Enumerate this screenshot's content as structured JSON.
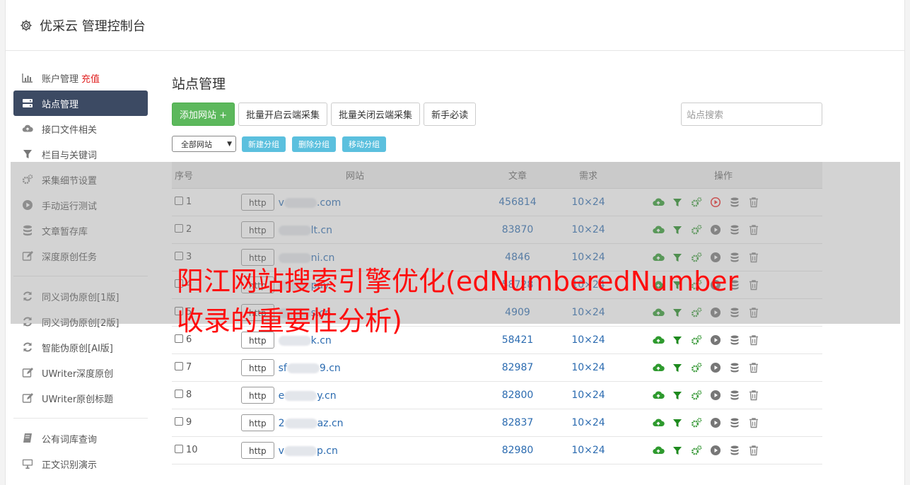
{
  "header": {
    "title": "优采云 管理控制台"
  },
  "sidebar": {
    "group1": [
      {
        "label": "账户管理",
        "extra": "充值",
        "icon": "bar-chart-icon"
      },
      {
        "label": "站点管理",
        "icon": "server-icon",
        "active": true
      },
      {
        "label": "接口文件相关",
        "icon": "cloud-upload-icon"
      },
      {
        "label": "栏目与关键词",
        "icon": "filter-icon"
      },
      {
        "label": "采集细节设置",
        "icon": "cogs-icon"
      },
      {
        "label": "手动运行测试",
        "icon": "play-circle-icon"
      },
      {
        "label": "文章暂存库",
        "icon": "database-icon"
      },
      {
        "label": "深度原创任务",
        "icon": "edit-icon"
      }
    ],
    "group2": [
      {
        "label": "同义词伪原创[1版]",
        "icon": "refresh-icon"
      },
      {
        "label": "同义词伪原创[2版]",
        "icon": "refresh-icon"
      },
      {
        "label": "智能伪原创[AI版]",
        "icon": "refresh-icon"
      },
      {
        "label": "UWriter深度原创",
        "icon": "edit-icon"
      },
      {
        "label": "UWriter原创标题",
        "icon": "edit-icon"
      }
    ],
    "group3": [
      {
        "label": "公有词库查询",
        "icon": "book-icon"
      },
      {
        "label": "正文识别演示",
        "icon": "monitor-icon"
      }
    ]
  },
  "main": {
    "title": "站点管理",
    "add_button": "添加网站 +",
    "batch_open": "批量开启云端采集",
    "batch_close": "批量关闭云端采集",
    "newbie": "新手必读",
    "search_placeholder": "站点搜索",
    "group_select": "全部网站",
    "new_group": "新建分组",
    "delete_group": "删除分组",
    "move_group": "移动分组"
  },
  "table": {
    "headers": [
      "序号",
      "网站",
      "文章",
      "需求",
      "操作"
    ],
    "http_label": "http",
    "rows": [
      {
        "no": "1",
        "pre": "v",
        "post": ".com",
        "articles": "456814",
        "need": "10×24",
        "running": true
      },
      {
        "no": "2",
        "pre": "",
        "post": "lt.cn",
        "articles": "83870",
        "need": "10×24",
        "running": false
      },
      {
        "no": "3",
        "pre": "",
        "post": "ni.cn",
        "articles": "4846",
        "need": "10×24",
        "running": false
      },
      {
        "no": "4",
        "pre": "",
        "post": "pay.",
        "articles": "58728",
        "need": "10×24",
        "running": false
      },
      {
        "no": "5",
        "pre": "",
        "post": "s.cn",
        "articles": "4909",
        "need": "10×24",
        "running": false
      },
      {
        "no": "6",
        "pre": "",
        "post": "k.cn",
        "articles": "58421",
        "need": "10×24",
        "running": false
      },
      {
        "no": "7",
        "pre": "sf",
        "post": "9.cn",
        "articles": "82987",
        "need": "10×24",
        "running": false
      },
      {
        "no": "8",
        "pre": "e",
        "post": "y.cn",
        "articles": "82800",
        "need": "10×24",
        "running": false
      },
      {
        "no": "9",
        "pre": "2",
        "post": "az.cn",
        "articles": "82837",
        "need": "10×24",
        "running": false
      },
      {
        "no": "10",
        "pre": "v",
        "post": "p.cn",
        "articles": "82980",
        "need": "10×24",
        "running": false
      }
    ]
  },
  "overlay_text": "阳江网站搜索引擎优化(edNumberedNumber收录的重要性分析)",
  "colors": {
    "active_nav": "#3c4a63",
    "green": "#5cb85c",
    "info": "#5bc0de",
    "link": "#2b6bb0",
    "red": "#e02020"
  }
}
